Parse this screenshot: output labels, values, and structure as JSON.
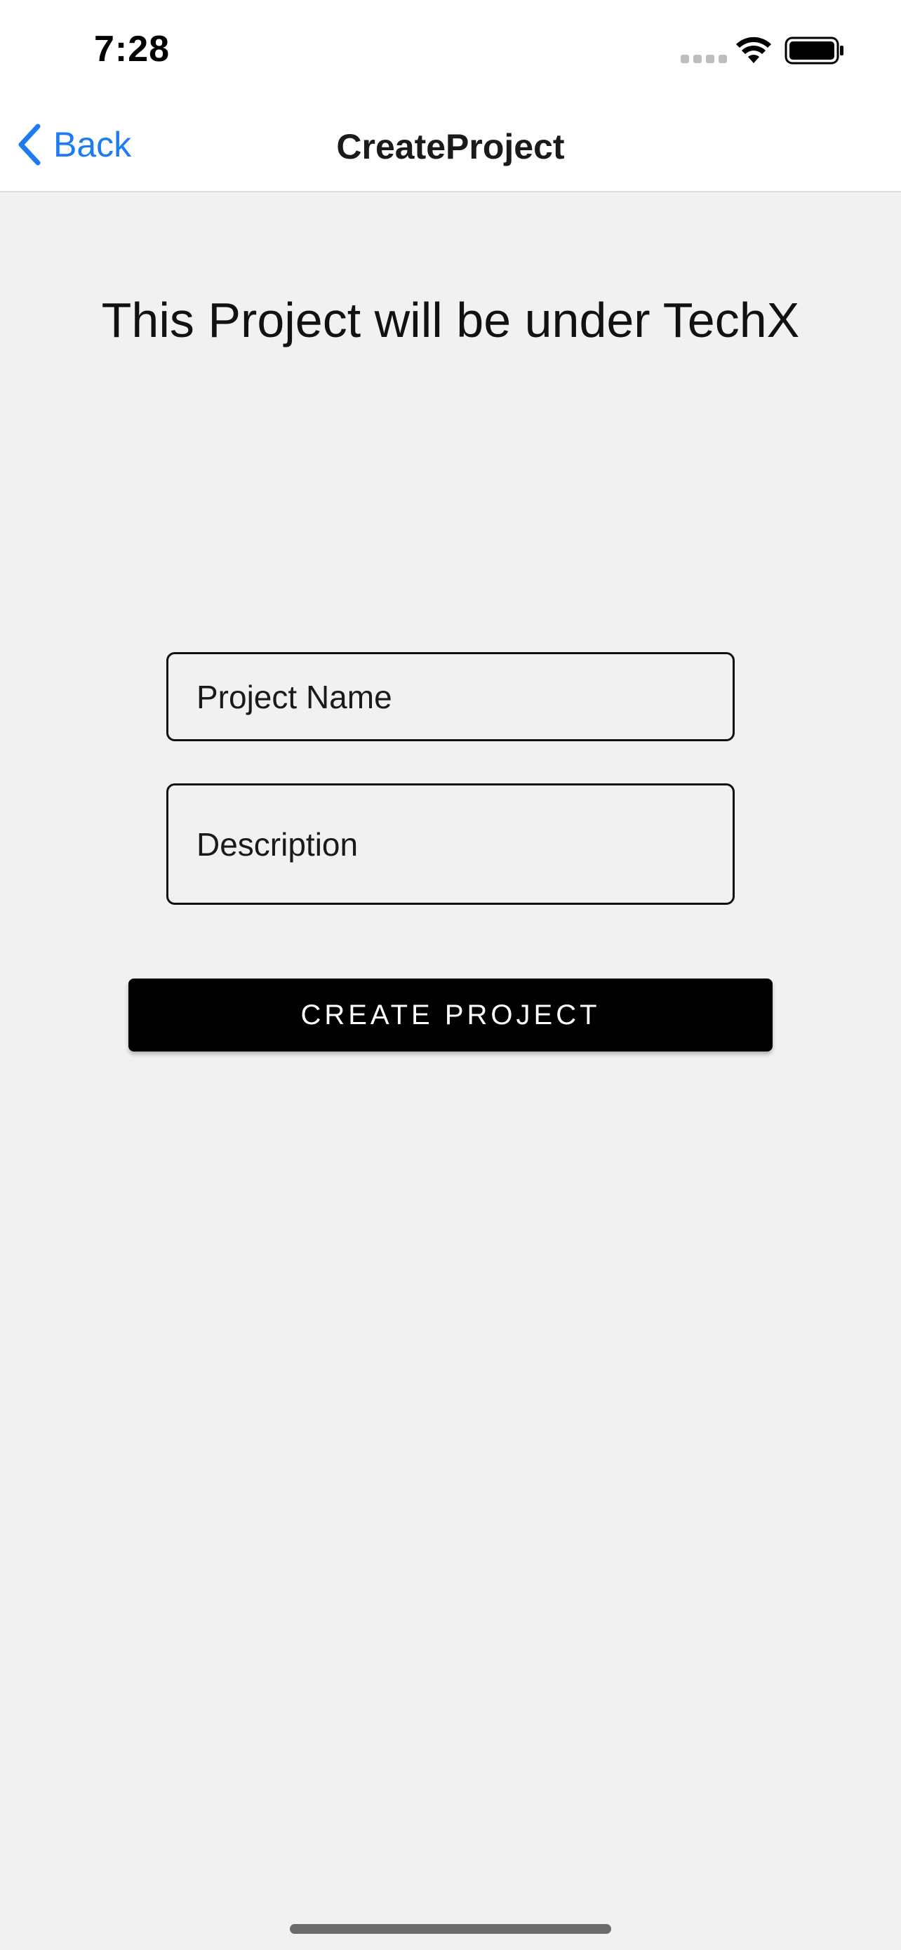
{
  "status_bar": {
    "time": "7:28",
    "icons": [
      "signal-icon",
      "wifi-icon",
      "battery-icon"
    ]
  },
  "nav": {
    "back_label": "Back",
    "title": "CreateProject",
    "accent_color": "#1e7cf2"
  },
  "main": {
    "heading": "This Project will be under TechX",
    "project_name": {
      "placeholder": "Project Name",
      "value": ""
    },
    "description": {
      "placeholder": "Description",
      "value": ""
    },
    "create_button_label": "CREATE PROJECT"
  }
}
